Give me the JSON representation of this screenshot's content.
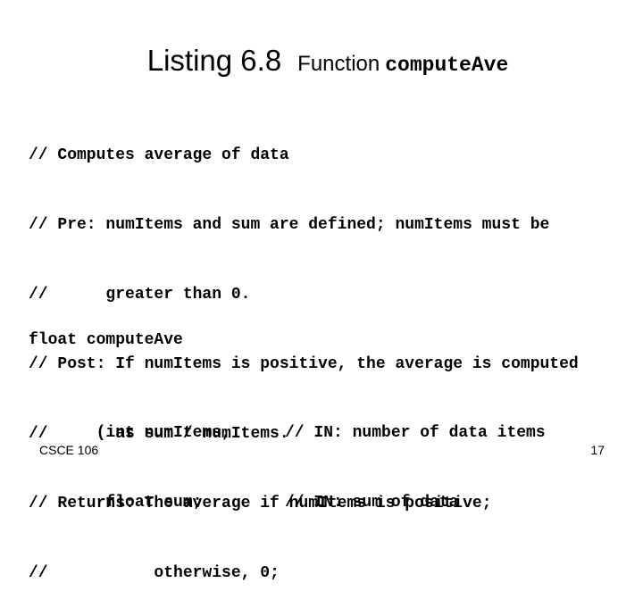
{
  "slide": {
    "title": {
      "main": "Listing 6.8",
      "sub": "Function",
      "code": "computeAve"
    },
    "comment_lines": [
      "// Computes average of data",
      "// Pre: numItems and sum are defined; numItems must be",
      "//      greater than 0.",
      "// Post: If numItems is positive, the average is computed",
      "//       as sum / numItems.",
      "// Returns: The average if numItems is positive;",
      "//           otherwise, 0;"
    ],
    "function": {
      "signature": "float computeAve",
      "params": [
        {
          "code": "   (int numItems,",
          "comment": "// IN: number of data items"
        },
        {
          "code": "    float sum;",
          "comment": "// IN: sum of data"
        }
      ]
    },
    "footer": {
      "course": "CSCE 106",
      "page_number": "17"
    }
  }
}
